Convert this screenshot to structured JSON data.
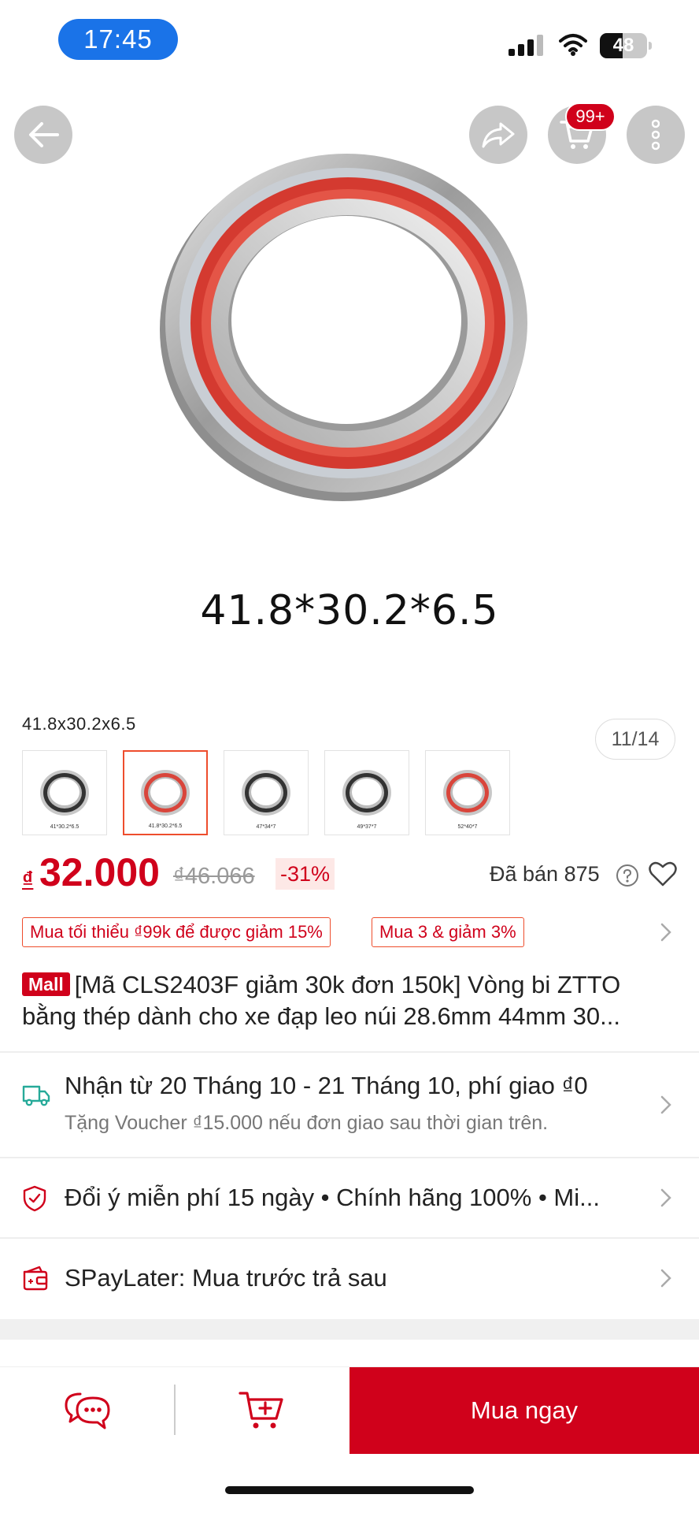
{
  "status_bar": {
    "time": "17:45",
    "battery_level": "48",
    "battery_fraction": 0.48
  },
  "header": {
    "cart_badge": "99+"
  },
  "gallery": {
    "caption": "41.8*30.2*6.5",
    "counter": "11/14"
  },
  "variants": {
    "selected_label": "41.8x30.2x6.5",
    "options": [
      {
        "caption": "41*30.2*6.5",
        "ring_color": "#333333"
      },
      {
        "caption": "41.8*30.2*6.5",
        "ring_color": "#d9453b"
      },
      {
        "caption": "47*34*7",
        "ring_color": "#333333"
      },
      {
        "caption": "49*37*7",
        "ring_color": "#333333"
      },
      {
        "caption": "52*40*7",
        "ring_color": "#d9453b"
      }
    ]
  },
  "price": {
    "currency_symbol": "₫",
    "current": "32.000",
    "original": "₫46.066",
    "discount": "-31%",
    "sold": "Đã bán 875"
  },
  "vouchers": [
    "Mua tối thiểu ₫99k để được giảm 15%",
    "Mua 3 & giảm 3%"
  ],
  "product": {
    "mall_badge": "Mall",
    "title": "[Mã CLS2403F giảm 30k đơn 150k] Vòng bi ZTTO bằng thép dành cho xe đạp leo núi 28.6mm 44mm 30..."
  },
  "shipping": {
    "main": "Nhận từ 20 Tháng 10 - 21 Tháng 10, phí giao ₫0",
    "sub": "Tặng Voucher ₫15.000 nếu đơn giao sau thời gian trên."
  },
  "guarantee": {
    "text": "Đổi ý miễn phí 15 ngày  •  Chính hãng 100%  •  Mi..."
  },
  "paylater": {
    "text": "SPayLater: Mua trước trả sau"
  },
  "bottom_bar": {
    "buy_label": "Mua ngay"
  },
  "colors": {
    "accent": "#d0011b",
    "accent_orange": "#ee4d2d",
    "shipping_teal": "#26aa99"
  }
}
